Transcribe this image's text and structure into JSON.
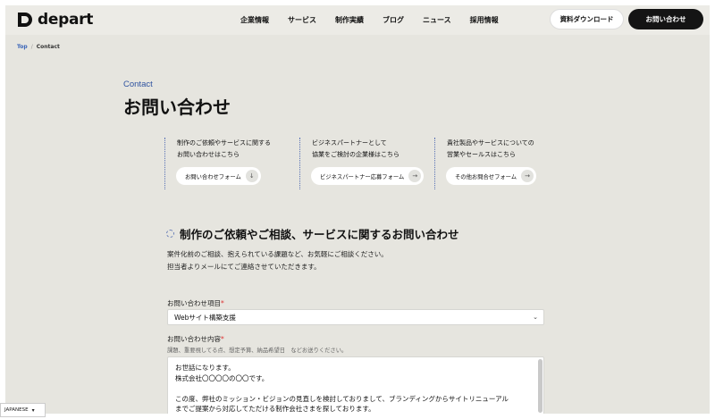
{
  "header": {
    "logo_text": "depart",
    "nav": [
      "企業情報",
      "サービス",
      "制作実績",
      "ブログ",
      "ニュース",
      "採用情報"
    ],
    "doc_button": "資料ダウンロード",
    "contact_button": "お問い合わせ"
  },
  "breadcrumb": {
    "top": "Top",
    "sep": "/",
    "current": "Contact"
  },
  "page": {
    "kicker": "Contact",
    "title": "お問い合わせ"
  },
  "cards": [
    {
      "line1": "制作のご依頼やサービスに関する",
      "line2": "お問い合わせはこちら",
      "button": "お問い合わせフォーム",
      "icon": "↓"
    },
    {
      "line1": "ビジネスパートナーとして",
      "line2": "協業をご検討の企業様はこちら",
      "button": "ビジネスパートナー応募フォーム",
      "icon": "→"
    },
    {
      "line1": "貴社製品やサービスについての",
      "line2": "営業やセールスはこちら",
      "button": "その他お問合せフォーム",
      "icon": "→"
    }
  ],
  "section": {
    "title": "制作のご依頼やご相談、サービスに関するお問い合わせ",
    "desc1": "案件化前のご相談、抱えられている課題など、お気軽にご相談ください。",
    "desc2": "担当者よりメールにてご連絡させていただきます。"
  },
  "form": {
    "item_label": "お問い合わせ項目",
    "required_mark": "*",
    "item_value": "Webサイト構築支援",
    "content_label": "お問い合わせ内容",
    "content_hint": "課題、重要視してる点、想定予算、納品希望日　などお送りください。",
    "content_lines": [
      "お世話になります。",
      "株式会社〇〇〇〇の〇〇です。",
      "",
      "この度、弊社のミッション・ビジョンの見直しを検討しておりまして、ブランディングからサイトリニューアル",
      "までご提案から対応してただける制作会社さまを探しております。"
    ]
  },
  "lang": {
    "label": "JAPANESE"
  }
}
